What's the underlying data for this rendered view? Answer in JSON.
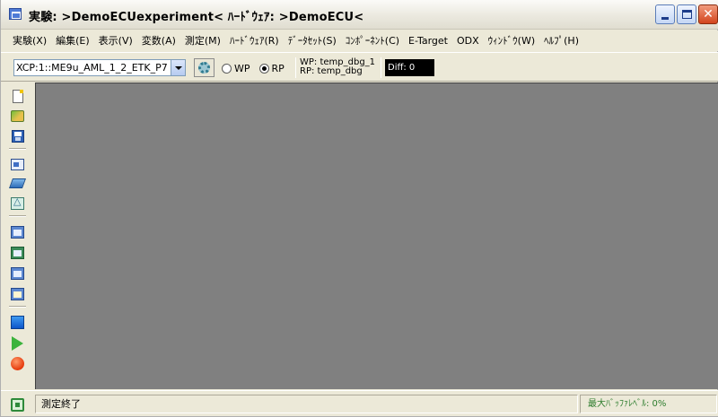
{
  "window": {
    "title": "実験: >DemoECUexperiment< ﾊｰﾄﾞｳｪｱ: >DemoECU<"
  },
  "menubar": {
    "items": [
      "実験(X)",
      "編集(E)",
      "表示(V)",
      "変数(A)",
      "測定(M)",
      "ﾊｰﾄﾞｳｪｱ(R)",
      "ﾃﾞｰﾀｾｯﾄ(S)",
      "ｺﾝﾎﾟｰﾈﾝﾄ(C)",
      "E-Target",
      "ODX",
      "ｳｨﾝﾄﾞｳ(W)",
      "ﾍﾙﾌﾟ(H)"
    ]
  },
  "toolbar": {
    "hardware_select_value": "XCP:1::ME9u_AML_1_2_ETK_P7",
    "radio_wp_label": "WP",
    "radio_rp_label": "RP",
    "radio_selected": "RP",
    "page_info_wp": "WP: temp_dbg_1",
    "page_info_rp": "RP: temp_dbg",
    "diff_label": "Diff: 0"
  },
  "left_toolbar": {
    "icons": [
      "new-document-icon",
      "open-icon",
      "save-icon",
      "panel-icon",
      "layers-icon",
      "chart-icon",
      "window-a-icon",
      "window-b-icon",
      "window-c-icon",
      "window-d-icon",
      "stop-square-icon",
      "play-icon",
      "record-icon"
    ]
  },
  "statusbar": {
    "message": "測定終了",
    "buffer_level": "最大ﾊﾞｯﾌｧﾚﾍﾞﾙ: 0%"
  },
  "colors": {
    "workspace": "#808080",
    "chrome": "#ece9d8",
    "diff_bg": "#000000",
    "buffer_text": "#2e7d2e"
  }
}
